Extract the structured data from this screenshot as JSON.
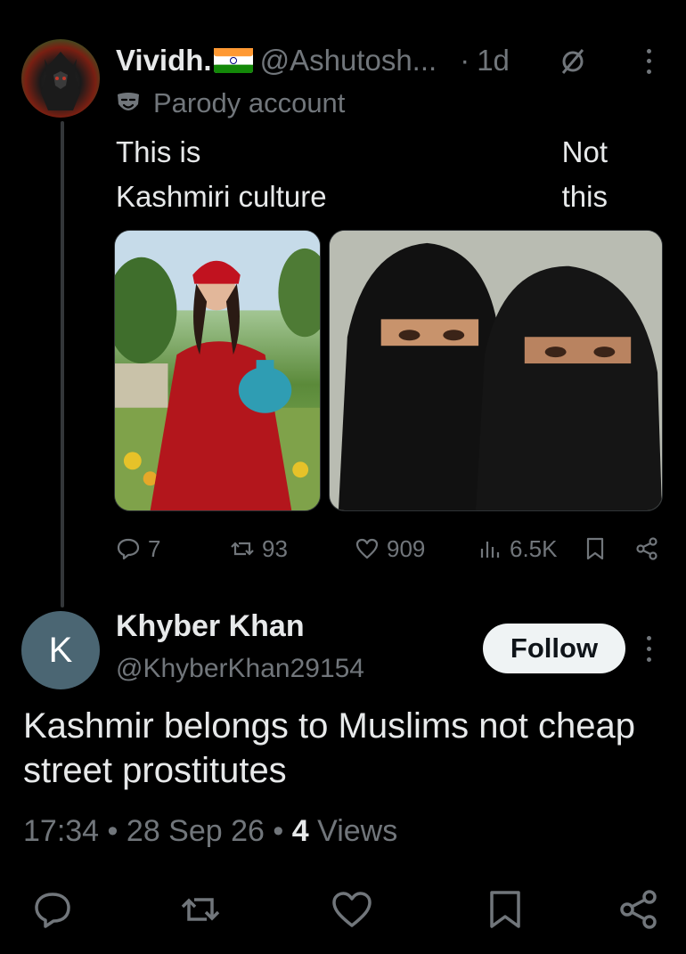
{
  "parent_tweet": {
    "display_name": "Vividh.",
    "handle": "@Ashutosh...",
    "separator": "·",
    "time": "1d",
    "badge_label": "Parody account",
    "text_left_line1": "This is",
    "text_left_line2": "Kashmiri culture",
    "text_right_line1": "Not",
    "text_right_line2": "this",
    "actions": {
      "replies": "7",
      "reposts": "93",
      "likes": "909",
      "views": "6.5K"
    }
  },
  "reply_tweet": {
    "avatar_letter": "K",
    "display_name": "Khyber Khan",
    "handle": "@KhyberKhan29154",
    "follow_label": "Follow",
    "text": "Kashmir belongs to Muslims not cheap street prostitutes",
    "meta": {
      "time": "17:34",
      "date": "28 Sep 26",
      "views_count": "4",
      "views_label": "Views",
      "sep": "•"
    }
  },
  "colors": {
    "background": "#000000",
    "text_primary": "#e7e9ea",
    "text_secondary": "#71767b",
    "follow_bg": "#eff3f4"
  }
}
